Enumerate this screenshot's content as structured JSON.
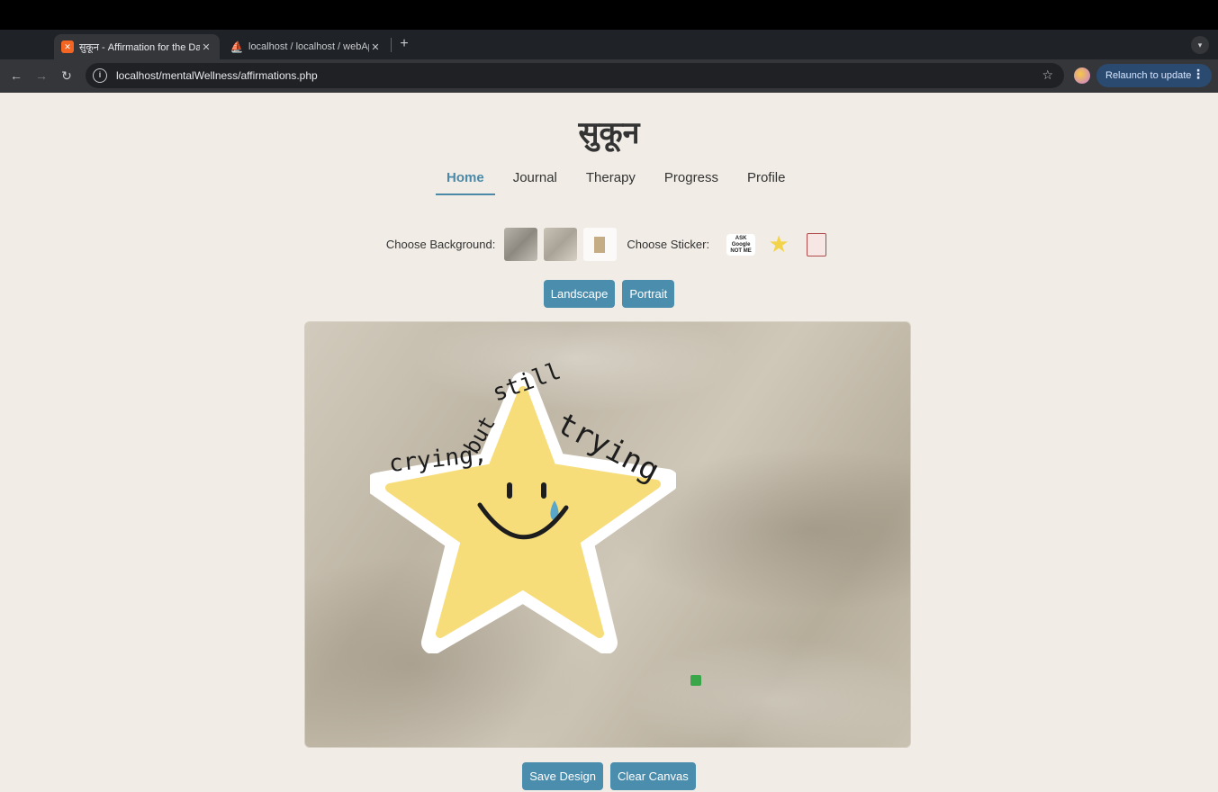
{
  "browser": {
    "tabs": [
      {
        "title": "सुकून - Affirmation for the Day",
        "favicon": "xampp-icon",
        "active": true
      },
      {
        "title": "localhost / localhost / webApp",
        "favicon": "phpmyadmin-icon",
        "active": false
      }
    ],
    "new_tab": "+",
    "url": "localhost/mentalWellness/affirmations.php",
    "relaunch_label": "Relaunch to update"
  },
  "page": {
    "brand": "सुकून",
    "nav": [
      {
        "label": "Home",
        "active": true
      },
      {
        "label": "Journal",
        "active": false
      },
      {
        "label": "Therapy",
        "active": false
      },
      {
        "label": "Progress",
        "active": false
      },
      {
        "label": "Profile",
        "active": false
      }
    ],
    "choose_background_label": "Choose Background:",
    "choose_sticker_label": "Choose Sticker:",
    "sticker_google_text": "ASK Google NOT ME",
    "orientation_buttons": {
      "landscape": "Landscape",
      "portrait": "Portrait"
    },
    "canvas_sticker": {
      "words": [
        "crying,",
        "but",
        "still",
        "trying"
      ]
    },
    "actions": {
      "save": "Save Design",
      "clear": "Clear Canvas"
    }
  },
  "colors": {
    "accent": "#4b8dad",
    "page_bg": "#f1ede6",
    "star": "#f7dd7a"
  }
}
